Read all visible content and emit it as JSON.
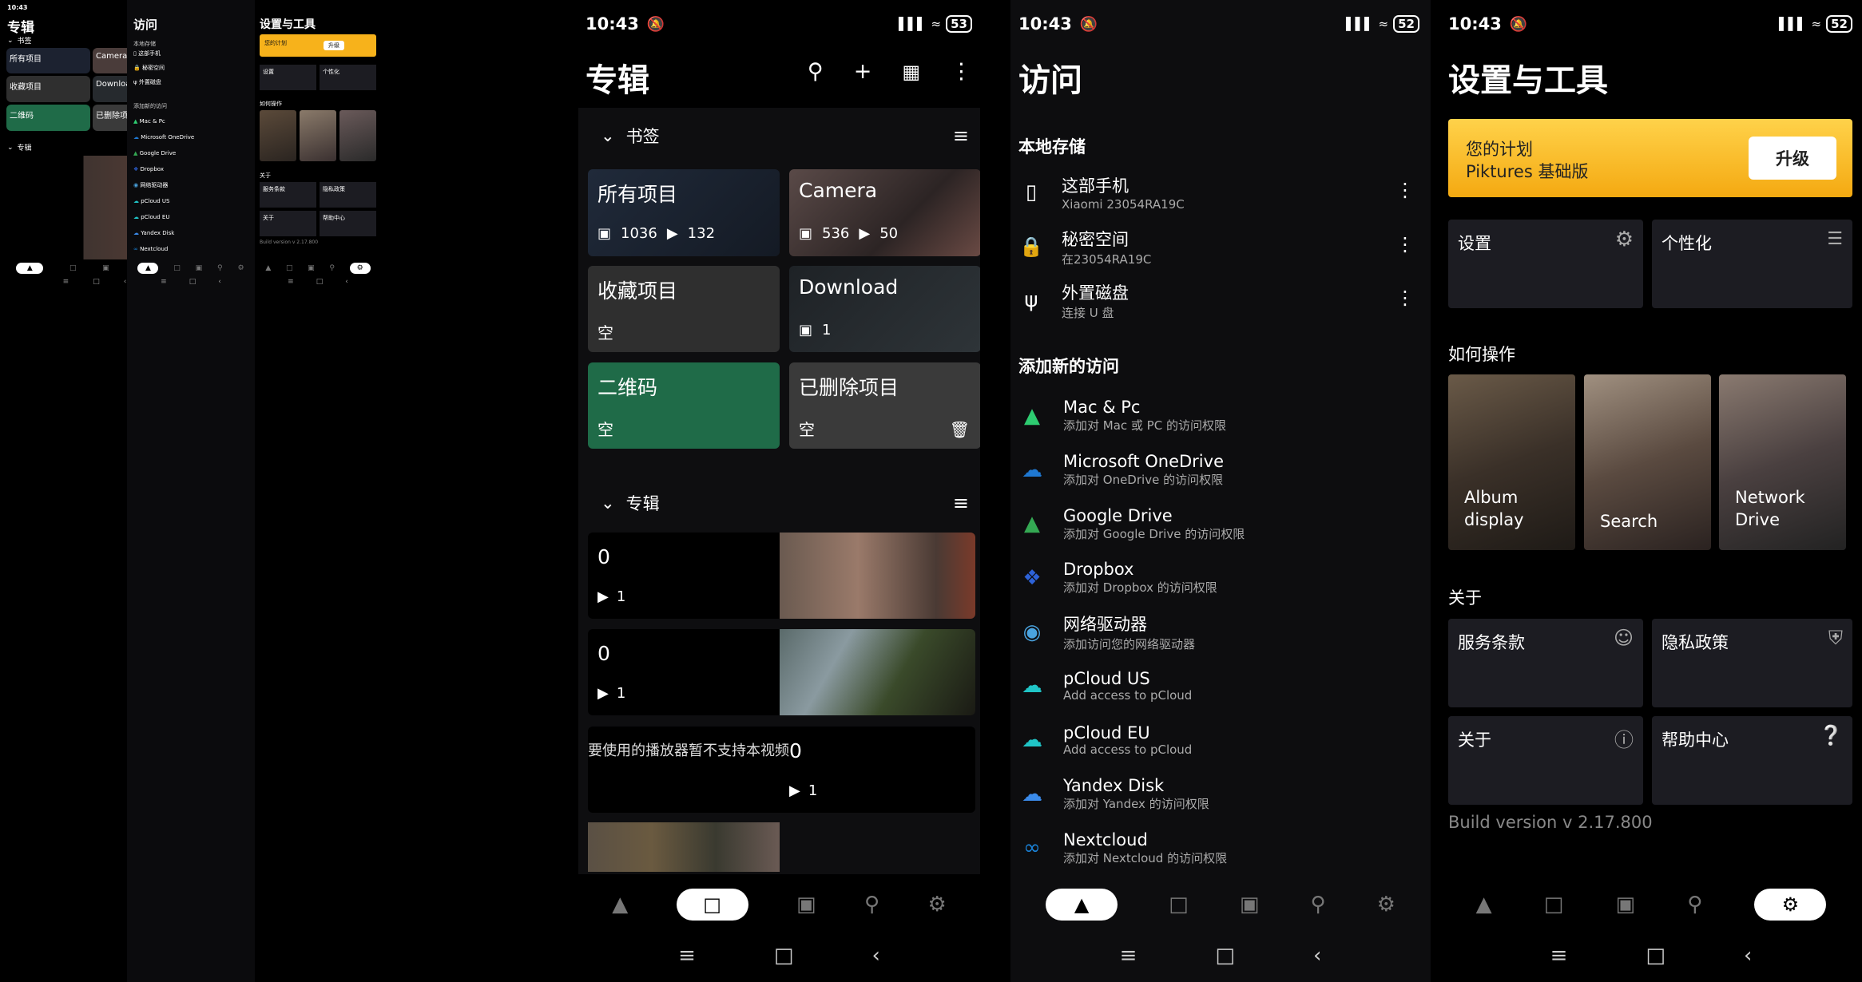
{
  "status": {
    "time": "10:43",
    "small_battery": "53",
    "battery_1": "53",
    "battery_2": "52",
    "battery_3": "52"
  },
  "albums_screen": {
    "title": "专辑",
    "bookmarks_label": "书签",
    "albums_label": "专辑",
    "tiles": {
      "all": {
        "title": "所有项目",
        "photos": "1036",
        "videos": "132"
      },
      "camera": {
        "title": "Camera",
        "photos": "536",
        "videos": "50"
      },
      "favorites": {
        "title": "收藏项目",
        "sub": "空"
      },
      "download": {
        "title": "Download",
        "photos": "1"
      },
      "qr": {
        "title": "二维码",
        "sub": "空"
      },
      "deleted": {
        "title": "已删除项目",
        "sub": "空"
      }
    },
    "album_rows": [
      {
        "count": "0",
        "videos": "1"
      },
      {
        "count": "0",
        "videos": "1"
      },
      {
        "count": "0",
        "videos": "1"
      }
    ],
    "partial_text": "要使用的播放器暂不支持本视频"
  },
  "access_screen": {
    "title": "访问",
    "local_label": "本地存储",
    "local": [
      {
        "name": "这部手机",
        "sub": "Xiaomi 23054RA19C",
        "icon": "phone-icon"
      },
      {
        "name": "秘密空间",
        "sub": "在23054RA19C",
        "icon": "lock-icon"
      },
      {
        "name": "外置磁盘",
        "sub": "连接 U 盘",
        "icon": "usb-icon"
      }
    ],
    "add_label": "添加新的访问",
    "services": [
      {
        "name": "Mac & Pc",
        "sub": "添加对 Mac 或 PC 的访问权限",
        "icon": "mac-pc-icon",
        "color": "#2ecc71"
      },
      {
        "name": "Microsoft OneDrive",
        "sub": "添加对 OneDrive 的访问权限",
        "icon": "onedrive-icon",
        "color": "#1f78d1"
      },
      {
        "name": "Google Drive",
        "sub": "添加对 Google Drive 的访问权限",
        "icon": "google-drive-icon",
        "color": "#34a853"
      },
      {
        "name": "Dropbox",
        "sub": "添加对 Dropbox 的访问权限",
        "icon": "dropbox-icon",
        "color": "#2d62d8"
      },
      {
        "name": "网络驱动器",
        "sub": "添加访问您的网络驱动器",
        "icon": "network-drive-icon",
        "color": "#4aa3df"
      },
      {
        "name": "pCloud US",
        "sub": "Add access to pCloud",
        "icon": "pcloud-icon",
        "color": "#20c5c7"
      },
      {
        "name": "pCloud EU",
        "sub": "Add access to pCloud",
        "icon": "pcloud-icon",
        "color": "#20c5c7"
      },
      {
        "name": "Yandex Disk",
        "sub": "添加对 Yandex 的访问权限",
        "icon": "yandex-disk-icon",
        "color": "#3b8bea"
      },
      {
        "name": "Nextcloud",
        "sub": "添加对 Nextcloud 的访问权限",
        "icon": "nextcloud-icon",
        "color": "#1a82d8"
      }
    ]
  },
  "settings_screen": {
    "title": "设置与工具",
    "plan_title": "您的计划",
    "plan_name": "Piktures 基础版",
    "upgrade": "升级",
    "settings": "设置",
    "personalize": "个性化",
    "howto_label": "如何操作",
    "howto": [
      "Album display",
      "Search",
      "Network Drive"
    ],
    "about_label": "关于",
    "terms": "服务条款",
    "privacy": "隐私政策",
    "about": "关于",
    "help": "帮助中心",
    "build": "Build version v 2.17.800"
  },
  "colors": {
    "accent_yellow": "#f7b21b",
    "tile_gray": "#2f2f2f",
    "tile_green": "#1f6b48",
    "panel": "#1c1c22"
  }
}
